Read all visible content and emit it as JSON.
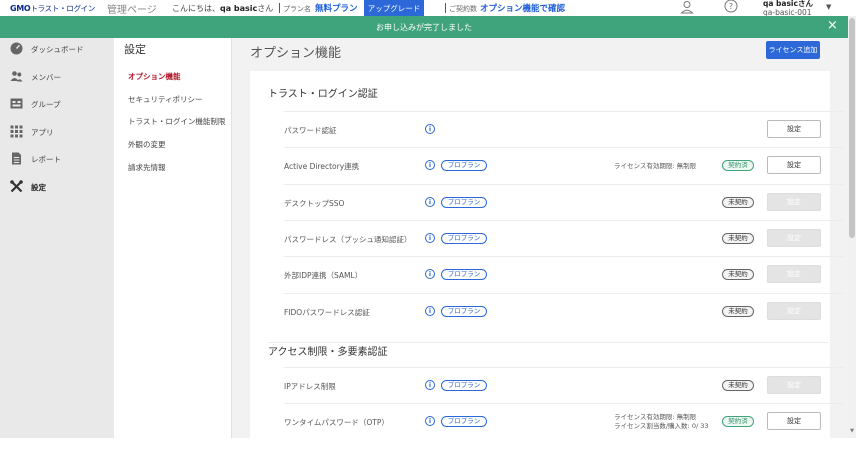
{
  "topbar": {
    "logo_brand": "GMO",
    "logo_rest": "トラスト・ログイン",
    "admin_label": "管理ページ",
    "greeting_prefix": "こんにちは、",
    "greeting_name": "qa basic",
    "greeting_suffix": "さん",
    "plan_label": "プラン名",
    "plan_value": "無料プラン",
    "upgrade_label": "アップグレード",
    "contract_label": "ご契約数",
    "contract_value": "オプション機能で確認",
    "user_name": "qa basicさん",
    "user_id": "qa-basic-001",
    "icons": [
      "user-icon",
      "help-icon",
      "caret-down-icon"
    ]
  },
  "notice": {
    "text": "お申し込みが完了しました",
    "close": "×",
    "color": "#3fa37c"
  },
  "sidebar": {
    "items": [
      {
        "label": "ダッシュボード",
        "icon": "dashboard-icon"
      },
      {
        "label": "メンバー",
        "icon": "members-icon"
      },
      {
        "label": "グループ",
        "icon": "group-icon"
      },
      {
        "label": "アプリ",
        "icon": "apps-grid-icon"
      },
      {
        "label": "レポート",
        "icon": "report-icon"
      },
      {
        "label": "設定",
        "icon": "settings-tools-icon"
      }
    ]
  },
  "submenu": {
    "title": "設定",
    "items": [
      {
        "label": "オプション機能"
      },
      {
        "label": "セキュリティポリシー"
      },
      {
        "label": "トラスト・ログイン機能制限"
      },
      {
        "label": "外観の変更"
      },
      {
        "label": "請求先情報"
      }
    ]
  },
  "main": {
    "title": "オプション機能",
    "license_button": "ライセンス追加",
    "sections": [
      {
        "title": "トラスト・ログイン認証",
        "rows": [
          {
            "label": "パスワード認証",
            "pro": "",
            "license": "",
            "status": "",
            "button": "設定",
            "enabled": true
          },
          {
            "label": "Active Directory連携",
            "pro": "プロプラン",
            "license": "ライセンス有効期限: 無制限",
            "status": "契約済",
            "button": "設定",
            "enabled": true
          },
          {
            "label": "デスクトップSSO",
            "pro": "プロプラン",
            "license": "",
            "status": "未契約",
            "button": "設定",
            "enabled": false
          },
          {
            "label": "パスワードレス（プッシュ通知認証）",
            "pro": "プロプラン",
            "license": "",
            "status": "未契約",
            "button": "設定",
            "enabled": false
          },
          {
            "label": "外部IDP連携（SAML）",
            "pro": "プロプラン",
            "license": "",
            "status": "未契約",
            "button": "設定",
            "enabled": false
          },
          {
            "label": "FIDOパスワードレス認証",
            "pro": "プロプラン",
            "license": "",
            "status": "未契約",
            "button": "設定",
            "enabled": false
          }
        ]
      },
      {
        "title": "アクセス制限・多要素認証",
        "rows": [
          {
            "label": "IPアドレス制限",
            "pro": "プロプラン",
            "license": "",
            "status": "未契約",
            "button": "設定",
            "enabled": false
          },
          {
            "label": "ワンタイムパスワード（OTP）",
            "pro": "プロプラン",
            "license": "ライセンス有効期限: 無制限",
            "license2": "ライセンス割当数/購入数: 0/ 33",
            "status": "契約済",
            "button": "設定",
            "enabled": true
          }
        ]
      }
    ]
  },
  "colors": {
    "accent": "#2c68d8",
    "success": "#3fa37c",
    "active_menu": "#b0182a",
    "sidebar_bg": "#e9e9ea"
  }
}
